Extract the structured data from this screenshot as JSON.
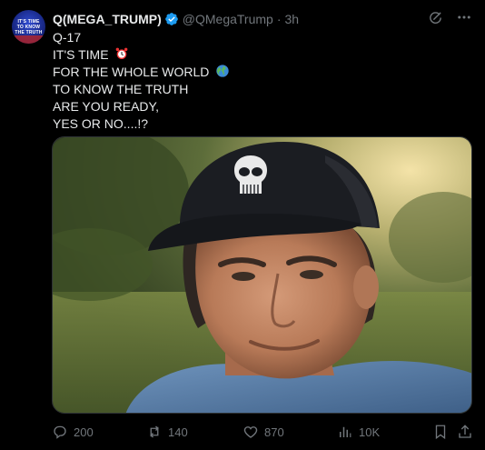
{
  "tweet": {
    "author_name": "Q(MEGA_TRUMP)",
    "handle": "@QMegaTrump",
    "separator": "·",
    "time": "3h",
    "avatar_text": "IT'S TIME TO KNOW THE TRUTH",
    "lines": [
      "Q-17",
      "IT'S TIME",
      "FOR THE WHOLE WORLD",
      "TO KNOW THE TRUTH",
      "ARE YOU READY,",
      "YES OR NO....!?"
    ],
    "emojis": {
      "alarm_clock": "alarm-clock-icon",
      "globe": "globe-icon"
    },
    "media": {
      "description_icon": "photo",
      "cap_logo": "skull-icon"
    }
  },
  "actions": {
    "replies": "200",
    "reposts": "140",
    "likes": "870",
    "views": "10K"
  },
  "colors": {
    "background": "#000000",
    "text": "#e7e9ea",
    "secondary": "#71767b",
    "verified": "#1d9bf0"
  }
}
